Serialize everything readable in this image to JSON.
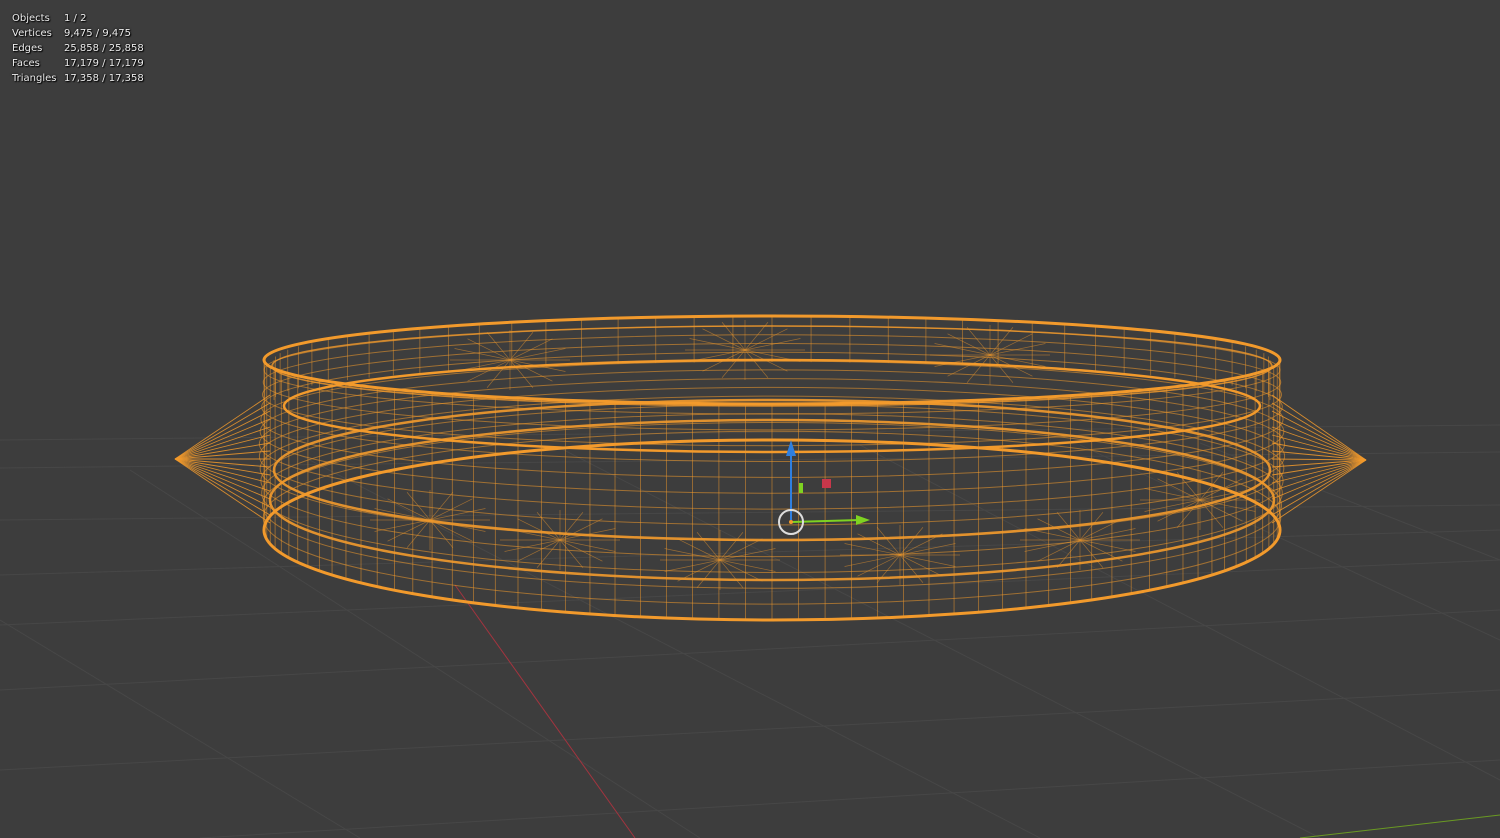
{
  "stats": [
    {
      "label": "Objects",
      "value": "1 / 2"
    },
    {
      "label": "Vertices",
      "value": "9,475 / 9,475"
    },
    {
      "label": "Edges",
      "value": "25,858 / 25,858"
    },
    {
      "label": "Faces",
      "value": "17,179 / 17,179"
    },
    {
      "label": "Triangles",
      "value": "17,358 / 17,358"
    }
  ],
  "colors": {
    "background": "#3d3d3d",
    "grid": "#474747",
    "x_axis": "#a3343f",
    "y_axis": "#6a9a23",
    "wire": "#f29a2c",
    "gizmo_z": "#2f7fe0",
    "gizmo_y": "#7ed321",
    "gizmo_x": "#c8374a",
    "pivot": "#dddddd"
  },
  "icons": {
    "pivot": "origin-circle-icon",
    "z_arrow": "z-arrow-icon",
    "y_arrow": "y-arrow-icon",
    "x_handle": "x-handle-icon"
  }
}
